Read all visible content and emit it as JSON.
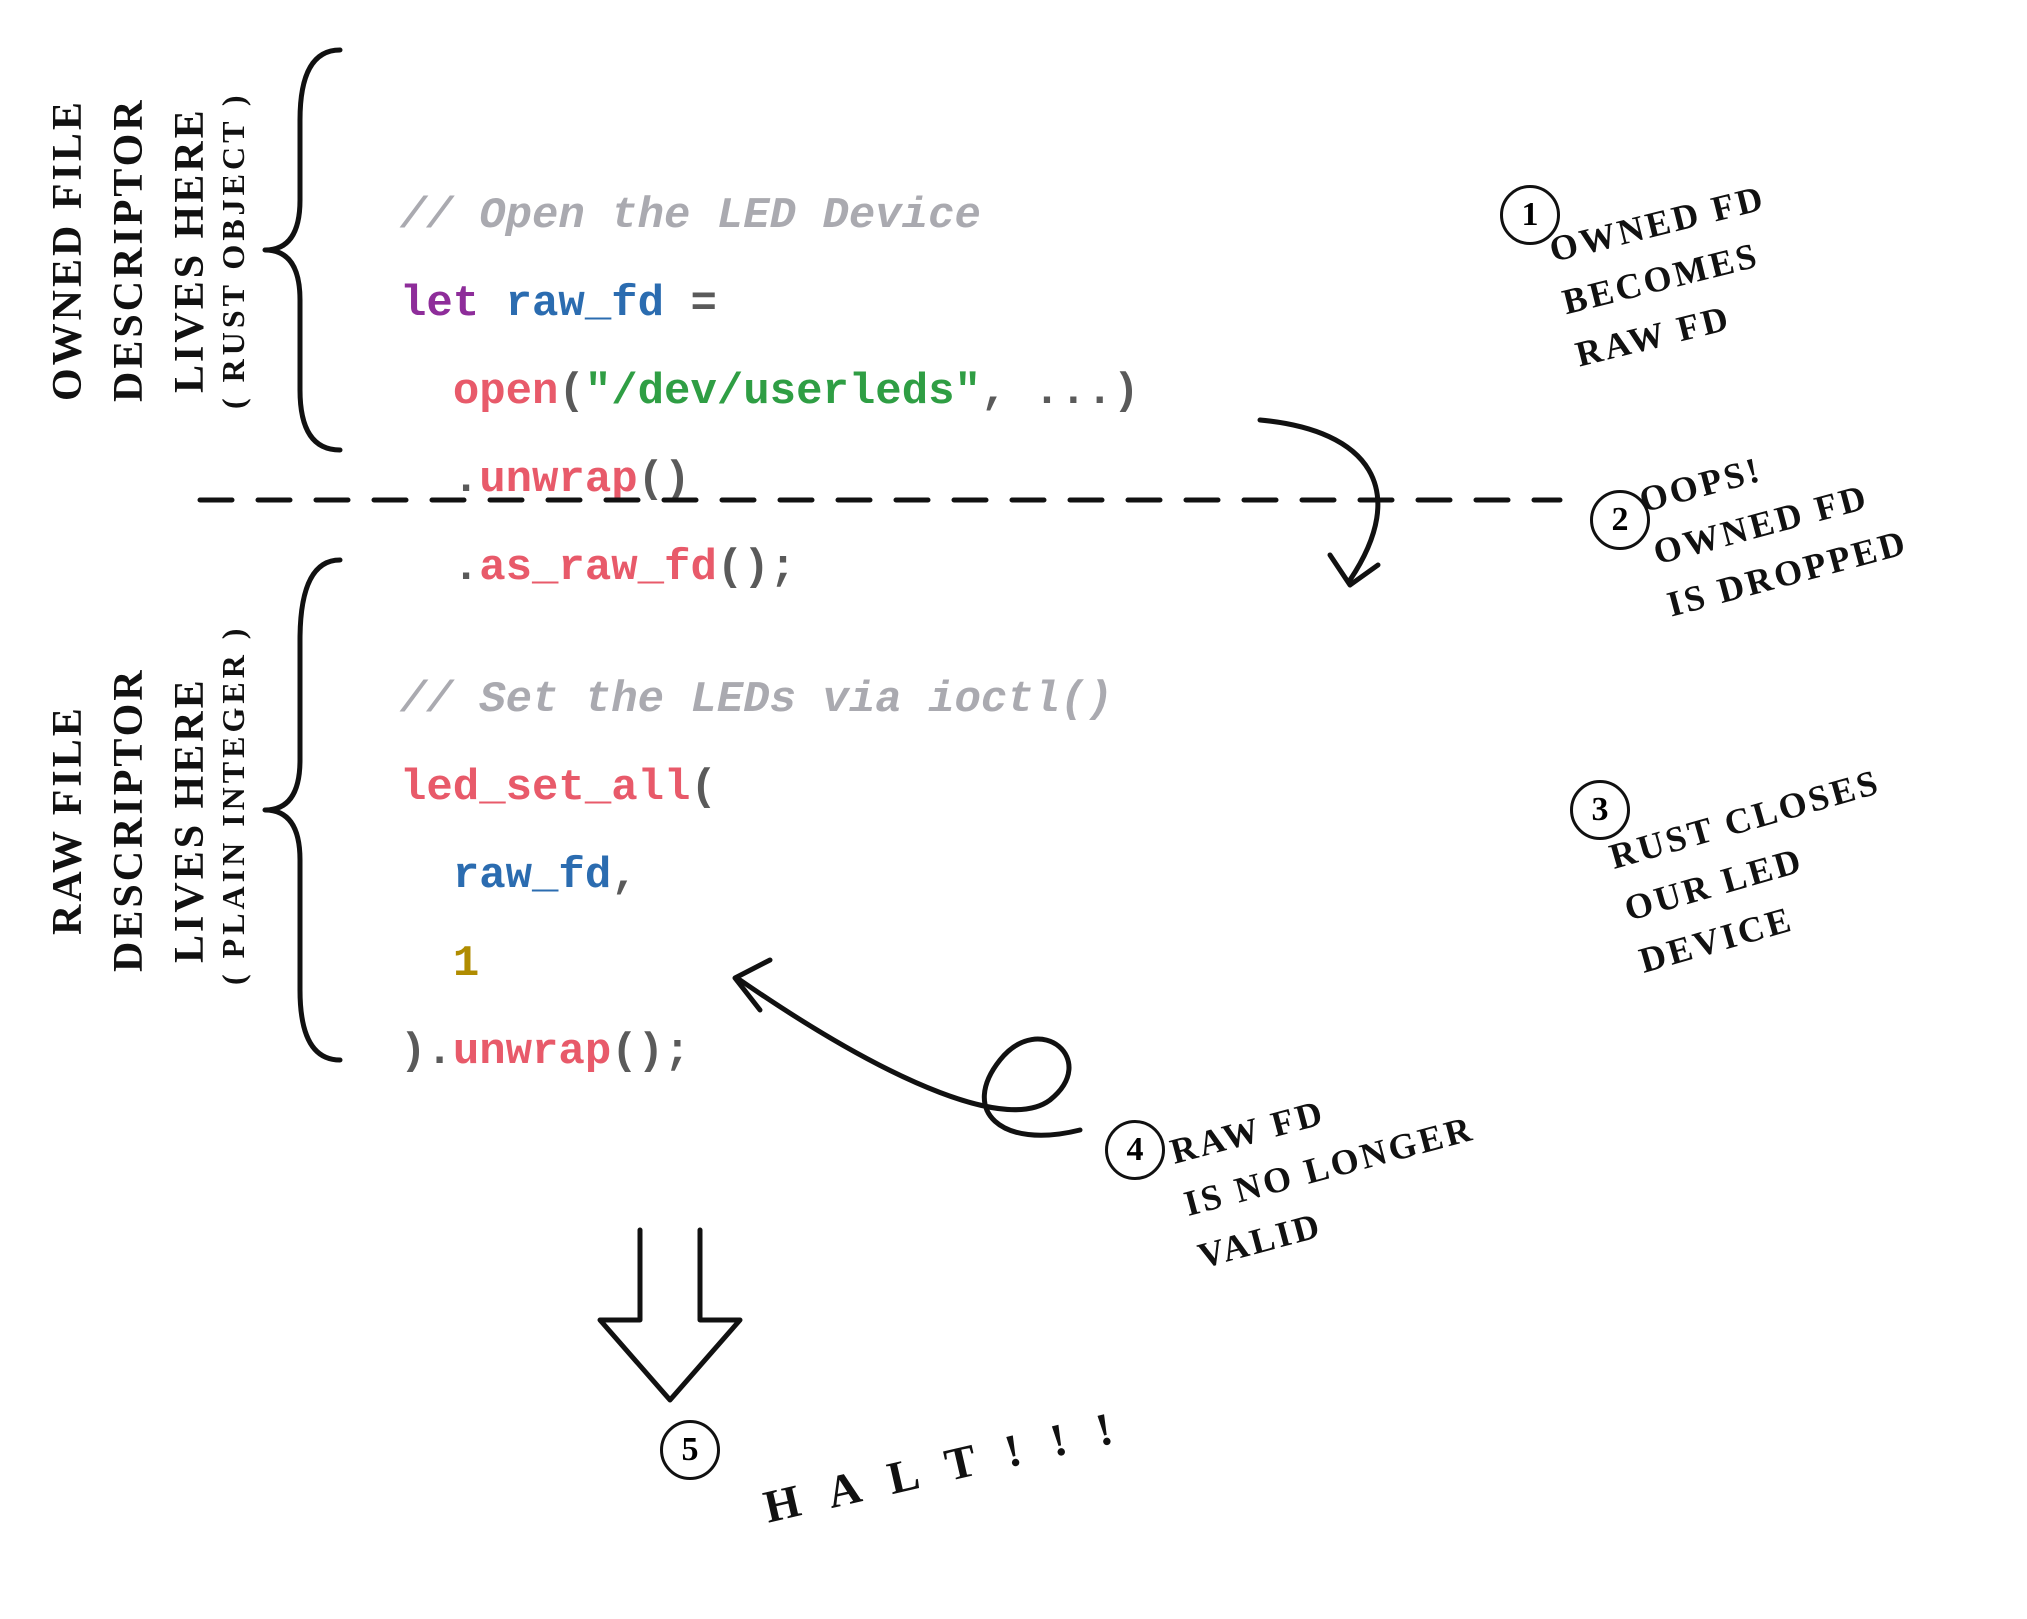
{
  "left_labels": {
    "owned_main": "OWNED FILE\nDESCRIPTOR\nLIVES HERE",
    "owned_sub": "( RUST OBJECT )",
    "raw_main": "RAW FILE\nDESCRIPTOR\nLIVES HERE",
    "raw_sub": "( PLAIN INTEGER )"
  },
  "code": {
    "c1": "// Open the LED Device",
    "let": "let",
    "raw_fd": "raw_fd",
    "eq": " =",
    "open": "open",
    "lp1": "(",
    "path": "\"/dev/userleds\"",
    "rest1": ", ...)",
    "dot1": ".",
    "unwrap1": "unwrap",
    "paren1": "()",
    "dot2": ".",
    "as_raw": "as_raw_fd",
    "paren2": "();",
    "c2": "// Set the LEDs via ioctl()",
    "led_set_all": "led_set_all",
    "lp2": "(",
    "raw_fd2": "raw_fd",
    "comma2": ",",
    "one": "1",
    "rp2": ").",
    "unwrap2": "unwrap",
    "paren3": "();"
  },
  "notes": {
    "n1_num": "1",
    "n1": "OWNED FD\nBECOMES\nRAW FD",
    "n2_num": "2",
    "n2": "OOPS!\nOWNED FD\nIS DROPPED",
    "n3_num": "3",
    "n3": "RUST CLOSES\nOUR LED\nDEVICE",
    "n4_num": "4",
    "n4": "RAW FD\nIS NO LONGER\nVALID",
    "n5_num": "5",
    "n5": "H A L T ! ! !"
  }
}
